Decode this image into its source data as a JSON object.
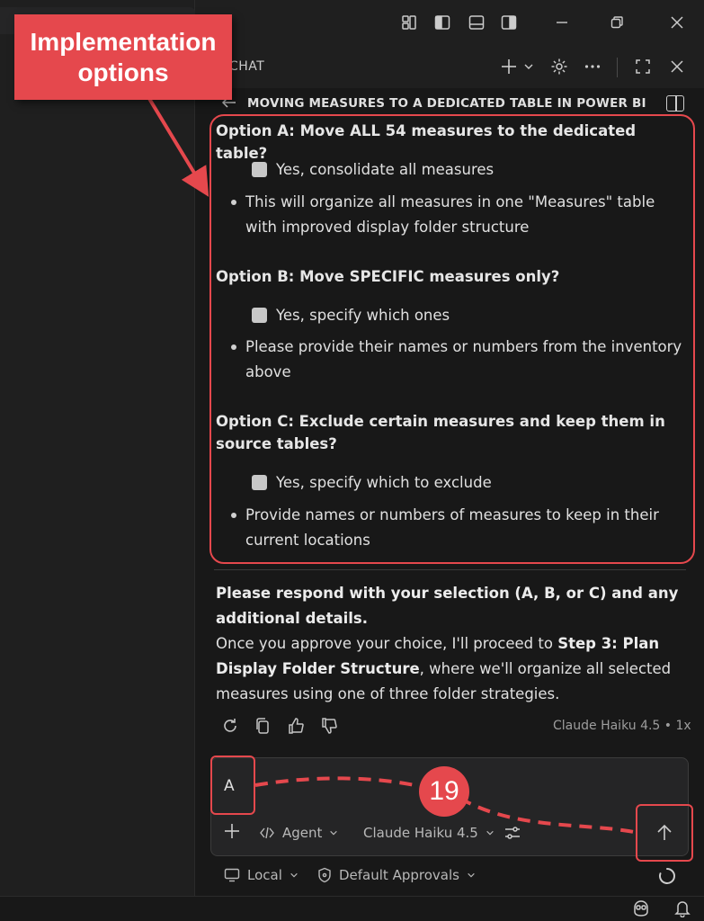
{
  "chat": {
    "header_title": "CHAT",
    "conversation_title": "MOVING MEASURES TO A DEDICATED TABLE IN POWER BI"
  },
  "options": [
    {
      "heading": "Option A: Move ALL 54 measures to the dedicated table?",
      "checkbox_label": "Yes, consolidate all measures",
      "bullet": "This will organize all measures in one \"Measures\" table with improved display folder structure"
    },
    {
      "heading": "Option B: Move SPECIFIC measures only?",
      "checkbox_label": "Yes, specify which ones",
      "bullet": "Please provide their names or numbers from the inventory above"
    },
    {
      "heading": "Option C: Exclude certain measures and keep them in source tables?",
      "checkbox_label": "Yes, specify which to exclude",
      "bullet": "Provide names or numbers of measures to keep in their current locations"
    }
  ],
  "response": {
    "prompt": "Please respond with your selection (A, B, or C) and any additional details.",
    "body_before": "Once you approve your choice, I'll proceed to ",
    "body_bold": "Step 3: Plan Display Folder Structure",
    "body_after": ", where we'll organize all selected measures using one of three folder strategies."
  },
  "meta": {
    "model_info": "Claude Haiku 4.5 • 1x"
  },
  "input": {
    "value": "A",
    "agent_label": "Agent",
    "model_label": "Claude Haiku 4.5"
  },
  "bottom": {
    "local_label": "Local",
    "approvals_label": "Default Approvals"
  },
  "annotations": {
    "callout": "Implementation options",
    "step_number": "19",
    "color": "#e5484d"
  },
  "colors": {
    "background": "#181818",
    "panel": "#1f1f1f",
    "input_bg": "#252526",
    "text": "#e0e0e0",
    "accent": "#e5484d"
  }
}
